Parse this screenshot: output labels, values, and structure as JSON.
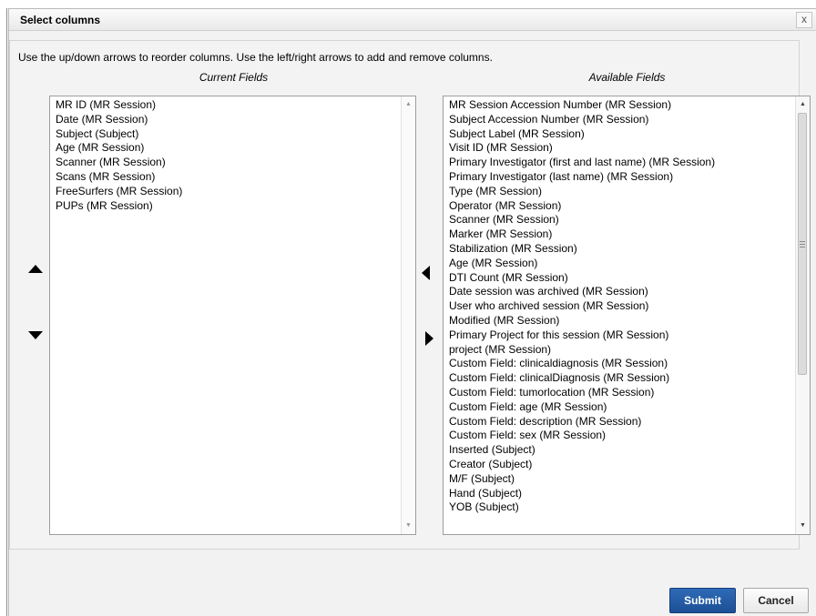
{
  "dialog": {
    "title": "Select columns",
    "close_glyph": "x",
    "instructions": "Use the up/down arrows to reorder columns. Use the left/right arrows to add and remove columns."
  },
  "current": {
    "heading": "Current Fields",
    "items": [
      "MR ID (MR Session)",
      "Date (MR Session)",
      "Subject (Subject)",
      "Age (MR Session)",
      "Scanner (MR Session)",
      "Scans (MR Session)",
      "FreeSurfers (MR Session)",
      "PUPs (MR Session)"
    ]
  },
  "available": {
    "heading": "Available Fields",
    "items": [
      "MR Session Accession Number (MR Session)",
      "Subject Accession Number (MR Session)",
      "Subject Label (MR Session)",
      "Visit ID (MR Session)",
      "Primary Investigator (first and last name) (MR Session)",
      "Primary Investigator (last name) (MR Session)",
      "Type (MR Session)",
      "Operator (MR Session)",
      "Scanner (MR Session)",
      "Marker (MR Session)",
      "Stabilization (MR Session)",
      "Age (MR Session)",
      "DTI Count (MR Session)",
      "Date session was archived (MR Session)",
      "User who archived session (MR Session)",
      "Modified (MR Session)",
      "Primary Project for this session (MR Session)",
      "project (MR Session)",
      "Custom Field: clinicaldiagnosis (MR Session)",
      "Custom Field: clinicalDiagnosis (MR Session)",
      "Custom Field: tumorlocation (MR Session)",
      "Custom Field: age (MR Session)",
      "Custom Field: description (MR Session)",
      "Custom Field: sex (MR Session)",
      "Inserted (Subject)",
      "Creator (Subject)",
      "M/F (Subject)",
      "Hand (Subject)",
      "YOB (Subject)"
    ]
  },
  "buttons": {
    "submit": "Submit",
    "cancel": "Cancel"
  },
  "icons": {
    "move_up": "triangle-up-icon",
    "move_down": "triangle-down-icon",
    "add": "triangle-left-icon",
    "remove": "triangle-right-icon"
  }
}
